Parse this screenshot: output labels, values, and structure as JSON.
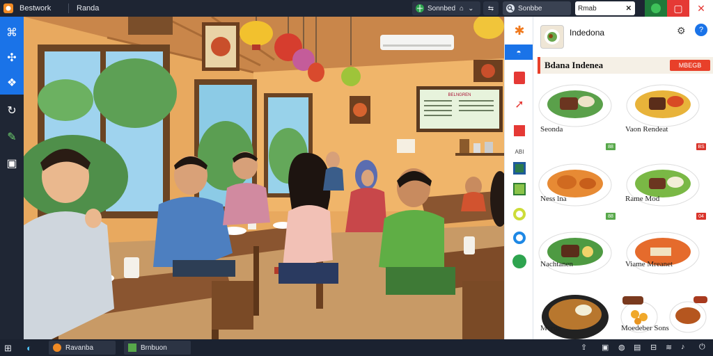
{
  "titlebar": {
    "app_name": "Bestwork",
    "doc_name": "Randa",
    "tab_label": "Sonnbed",
    "search_label": "Sonbbe",
    "search_value": "Rmab"
  },
  "panel": {
    "header_title": "Indedona",
    "section_title": "Bdana Indenea",
    "section_badge": "MBEGB",
    "items": [
      {
        "label": "Seonda",
        "badge": ""
      },
      {
        "label": "Vaon Rendeat",
        "badge": ""
      },
      {
        "label": "Ness lna",
        "badge": "88"
      },
      {
        "label": "Rame Mod",
        "badge": "BS"
      },
      {
        "label": "Nachtanen",
        "badge": "88"
      },
      {
        "label": "Viame Mreanet",
        "badge": "04"
      },
      {
        "label": "Meena",
        "badge": ""
      },
      {
        "label": "Moedeber Sons",
        "badge": ""
      }
    ]
  },
  "scene": {
    "menu_board_title": "BELNGREN"
  },
  "taskbar": {
    "task1": "Ravanba",
    "task2": "Brnbuon"
  },
  "colors": {
    "accent_blue": "#1a73e8",
    "close_red": "#e53935",
    "panel_red": "#e8402a",
    "badge_green": "#57a84a",
    "badge_red": "#d9342b"
  }
}
